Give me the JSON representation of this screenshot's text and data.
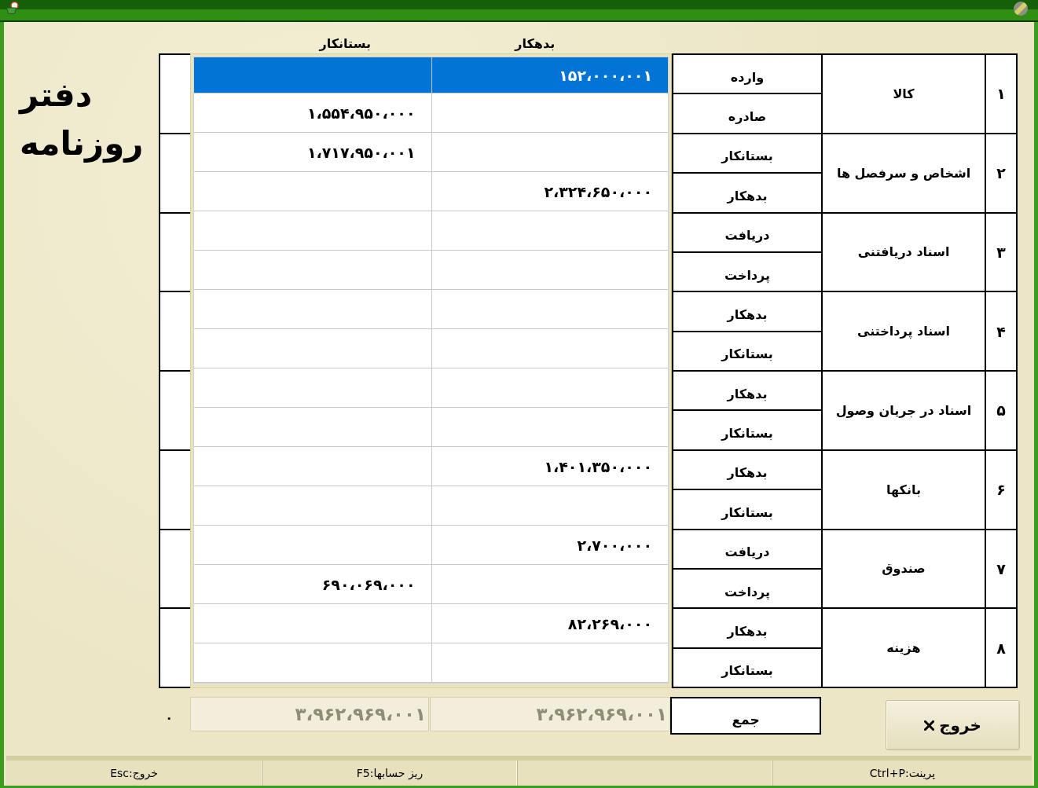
{
  "title": "دفتر روزنامه",
  "columns": [
    {
      "label": "بدهکار"
    },
    {
      "label": "بستانکار"
    }
  ],
  "entries": [
    {
      "selected": true,
      "debit": "۱۵۲،۰۰۰،۰۰۱"
    },
    {
      "selected": false,
      "credit": "۱،۵۵۴،۹۵۰،۰۰۰"
    },
    {
      "selected": false,
      "credit": "۱،۷۱۷،۹۵۰،۰۰۱"
    },
    {
      "selected": false,
      "debit": "۲،۳۲۴،۶۵۰،۰۰۰"
    },
    {
      "selected": false
    },
    {
      "selected": false
    },
    {
      "selected": false
    },
    {
      "selected": false
    },
    {
      "selected": false
    },
    {
      "selected": false
    },
    {
      "selected": false,
      "debit": "۱،۴۰۱،۳۵۰،۰۰۰"
    },
    {
      "selected": false
    },
    {
      "selected": false,
      "debit": "۲،۷۰۰،۰۰۰"
    },
    {
      "selected": false,
      "credit": "۶۹۰،۰۶۹،۰۰۰"
    },
    {
      "selected": false,
      "debit": "۸۲،۲۶۹،۰۰۰"
    },
    {
      "selected": false
    }
  ],
  "accounts": [
    {
      "number": "۱",
      "name": "کالا",
      "sides": [
        "وارده",
        "صادره"
      ]
    },
    {
      "number": "۲",
      "name": "اشخاص و سرفصل ها",
      "sides": [
        "بستانکار",
        "بدهکار"
      ]
    },
    {
      "number": "۳",
      "name": "اسناد دریافتنی",
      "sides": [
        "دریافت",
        "پرداخت"
      ]
    },
    {
      "number": "۴",
      "name": "اسناد پرداختنی",
      "sides": [
        "بدهکار",
        "بستانکار"
      ]
    },
    {
      "number": "۵",
      "name": "اسناد در جریان وصول",
      "sides": [
        "بدهکار",
        "بستانکار"
      ]
    },
    {
      "number": "۶",
      "name": "بانکها",
      "sides": [
        "بدهکار",
        "بستانکار"
      ]
    },
    {
      "number": "۷",
      "name": "صندوق",
      "sides": [
        "دریافت",
        "پرداخت"
      ]
    },
    {
      "number": "۸",
      "name": "هزینه",
      "sides": [
        "بدهکار",
        "بستانکار"
      ]
    }
  ],
  "totals": {
    "label": "جمع",
    "debit": {
      "value": "۳،۹۶۲،۹۶۹،۰۰۱",
      "disabled": true
    },
    "credit": {
      "value": "۳،۹۶۲،۹۶۹،۰۰۱",
      "disabled": true
    },
    "column_3_total": "۰"
  },
  "exit_button": {
    "label": "خروج"
  },
  "status_bar": [
    {
      "kind": "text",
      "text": "پرینت:Ctrl+P"
    },
    {
      "kind": "blank"
    },
    {
      "kind": "text",
      "text": "ریز حسابها:F5"
    },
    {
      "kind": "text",
      "text": "خروج:Esc"
    }
  ]
}
